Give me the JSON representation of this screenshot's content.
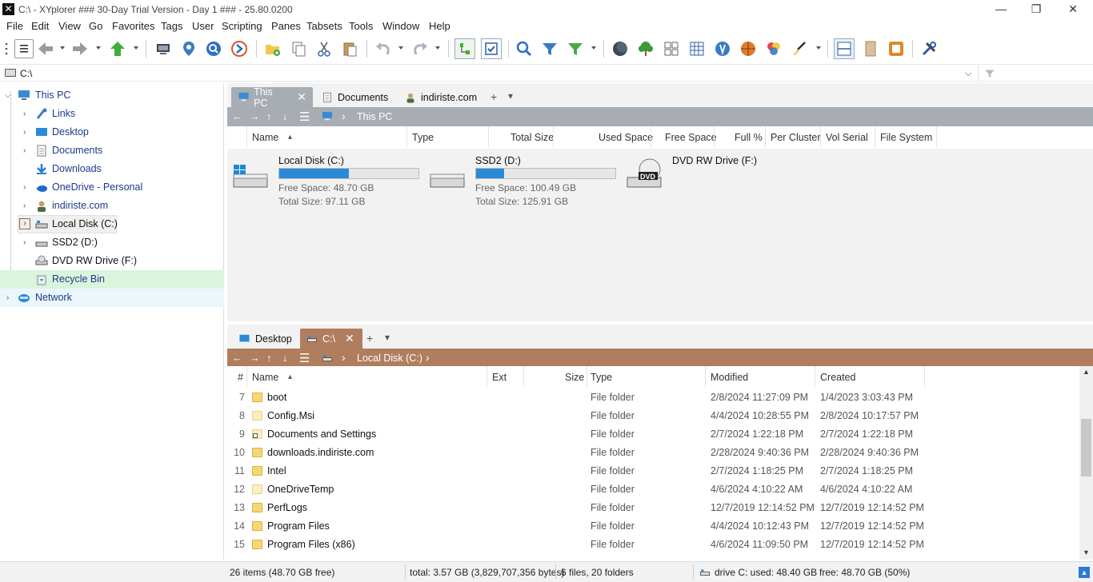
{
  "window": {
    "title": "C:\\ - XYplorer ### 30-Day Trial Version - Day 1 ### - 25.80.0200",
    "logo_glyph": "✕",
    "controls": {
      "minimize": "—",
      "maximize": "❐",
      "close": "✕"
    }
  },
  "menu": [
    "File",
    "Edit",
    "View",
    "Go",
    "Favorites",
    "Tags",
    "User",
    "Scripting",
    "Panes",
    "Tabsets",
    "Tools",
    "Window",
    "Help"
  ],
  "address": {
    "value": "C:\\",
    "dropdown_glyph": "⌵",
    "filter_icon": "funnel-icon"
  },
  "tree": [
    {
      "label": "This PC",
      "icon": "computer-icon",
      "level": 0,
      "expanded": true
    },
    {
      "label": "Links",
      "icon": "link-icon",
      "level": 1
    },
    {
      "label": "Desktop",
      "icon": "desktop-icon",
      "level": 1
    },
    {
      "label": "Documents",
      "icon": "document-icon",
      "level": 1
    },
    {
      "label": "Downloads",
      "icon": "download-icon",
      "level": 1
    },
    {
      "label": "OneDrive - Personal",
      "icon": "cloud-icon",
      "level": 1
    },
    {
      "label": "indiriste.com",
      "icon": "user-icon",
      "level": 1
    },
    {
      "label": "Local Disk (C:)",
      "icon": "drive-icon",
      "level": 1,
      "selected": true
    },
    {
      "label": "SSD2 (D:)",
      "icon": "drive-icon",
      "level": 1
    },
    {
      "label": "DVD RW Drive (F:)",
      "icon": "dvd-icon",
      "level": 1
    },
    {
      "label": "Recycle Bin",
      "icon": "recycle-bin-icon",
      "level": 1
    },
    {
      "label": "Network",
      "icon": "network-icon",
      "level": 0
    }
  ],
  "pane1": {
    "tabs": [
      {
        "label": "This PC",
        "icon": "computer-icon",
        "active": true,
        "close": "✕"
      },
      {
        "label": "Documents",
        "icon": "document-icon"
      },
      {
        "label": "indiriste.com",
        "icon": "user-icon"
      }
    ],
    "tab_add": "+",
    "tab_menu": "▾",
    "crumb": "This PC",
    "crumb_sep": "›",
    "columns": [
      "Name",
      "Type",
      "Total Size",
      "Used Space",
      "Free Space",
      "Full %",
      "Per Cluster",
      "Vol Serial",
      "File System"
    ],
    "sort_glyph": "▴",
    "drives": [
      {
        "name": "Local Disk (C:)",
        "free": "Free Space: 48.70 GB",
        "total": "Total Size: 97.11 GB",
        "used_fraction": 0.5
      },
      {
        "name": "SSD2 (D:)",
        "free": "Free Space: 100.49 GB",
        "total": "Total Size: 125.91 GB",
        "used_fraction": 0.2
      },
      {
        "name": "DVD RW Drive (F:)",
        "dvd_label": "DVD"
      }
    ],
    "accent": "#a7adb3"
  },
  "pane2": {
    "tabs": [
      {
        "label": "Desktop",
        "icon": "desktop-icon"
      },
      {
        "label": "C:\\",
        "icon": "drive-icon",
        "active": true,
        "close": "✕"
      }
    ],
    "tab_add": "+",
    "tab_menu": "▾",
    "crumb": "Local Disk (C:)",
    "crumb_sep": "›",
    "columns": [
      "#",
      "Name",
      "Ext",
      "Size",
      "Type",
      "Modified",
      "Created"
    ],
    "sort_glyph": "▴",
    "accent": "#b07e5e",
    "rows": [
      {
        "n": "7",
        "name": "boot",
        "type": "File folder",
        "modified": "2/8/2024 11:27:09 PM",
        "created": "1/4/2023 3:03:43 PM"
      },
      {
        "n": "8",
        "name": "Config.Msi",
        "type": "File folder",
        "modified": "4/4/2024 10:28:55 PM",
        "created": "2/8/2024 10:17:57 PM",
        "pale": true
      },
      {
        "n": "9",
        "name": "Documents and Settings",
        "type": "File folder",
        "modified": "2/7/2024 1:22:18 PM",
        "created": "2/7/2024 1:22:18 PM",
        "pale": true
      },
      {
        "n": "10",
        "name": "downloads.indiriste.com",
        "type": "File folder",
        "modified": "2/28/2024 9:40:36 PM",
        "created": "2/28/2024 9:40:36 PM"
      },
      {
        "n": "11",
        "name": "Intel",
        "type": "File folder",
        "modified": "2/7/2024 1:18:25 PM",
        "created": "2/7/2024 1:18:25 PM"
      },
      {
        "n": "12",
        "name": "OneDriveTemp",
        "type": "File folder",
        "modified": "4/6/2024 4:10:22 AM",
        "created": "4/6/2024 4:10:22 AM",
        "pale": true
      },
      {
        "n": "13",
        "name": "PerfLogs",
        "type": "File folder",
        "modified": "12/7/2019 12:14:52 PM",
        "created": "12/7/2019 12:14:52 PM"
      },
      {
        "n": "14",
        "name": "Program Files",
        "type": "File folder",
        "modified": "4/4/2024 10:12:43 PM",
        "created": "12/7/2019 12:14:52 PM"
      },
      {
        "n": "15",
        "name": "Program Files (x86)",
        "type": "File folder",
        "modified": "4/6/2024 11:09:50 PM",
        "created": "12/7/2019 12:14:52 PM"
      }
    ],
    "scroll_up": "▲",
    "scroll_down": "▼"
  },
  "status": {
    "items": "26 items (48.70 GB free)",
    "total": "total: 3.57 GB (3,829,707,356 bytes)",
    "counts": "6 files, 20 folders",
    "drive": "drive C:  used: 48.40 GB",
    "free": "free: 48.70 GB (50%)"
  }
}
